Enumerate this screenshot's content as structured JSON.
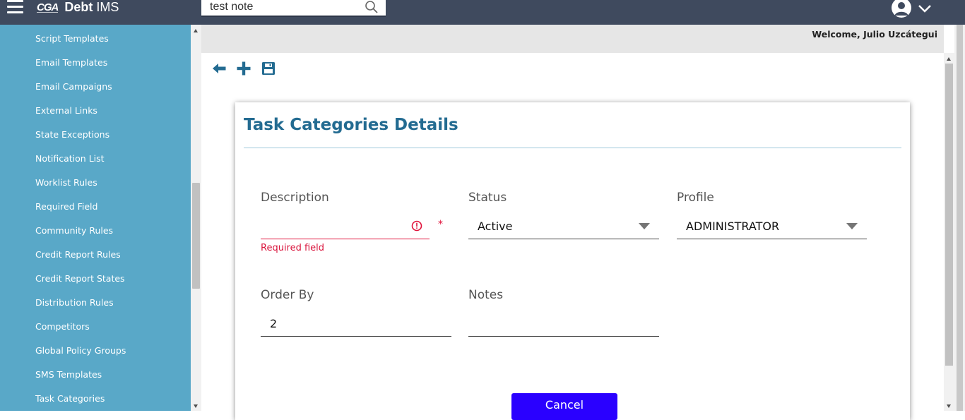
{
  "header": {
    "logo_mark": "CGA",
    "app_name_bold": "Debt",
    "app_name": "IMS",
    "search_value": "test note",
    "user_menu_icon": "chevron-down-icon"
  },
  "sidebar": {
    "items": [
      {
        "label": "Script Templates"
      },
      {
        "label": "Email Templates"
      },
      {
        "label": "Email Campaigns"
      },
      {
        "label": "External Links"
      },
      {
        "label": "State Exceptions"
      },
      {
        "label": "Notification List"
      },
      {
        "label": "Worklist Rules"
      },
      {
        "label": "Required Field"
      },
      {
        "label": "Community Rules"
      },
      {
        "label": "Credit Report Rules"
      },
      {
        "label": "Credit Report States"
      },
      {
        "label": "Distribution Rules"
      },
      {
        "label": "Competitors"
      },
      {
        "label": "Global Policy Groups"
      },
      {
        "label": "SMS Templates"
      },
      {
        "label": "Task Categories"
      }
    ]
  },
  "welcome_text": "Welcome, Julio Uzcátegui",
  "toolbar": {
    "icons": [
      "back-arrow-icon",
      "plus-icon",
      "save-icon"
    ]
  },
  "form": {
    "title": "Task Categories Details",
    "description": {
      "label": "Description",
      "value": "",
      "error": "Required field",
      "required_mark": "*"
    },
    "status": {
      "label": "Status",
      "value": "Active"
    },
    "profile": {
      "label": "Profile",
      "value": "ADMINISTRATOR"
    },
    "order_by": {
      "label": "Order By",
      "value": "2"
    },
    "notes": {
      "label": "Notes",
      "value": ""
    },
    "cancel_label": "Cancel"
  },
  "colors": {
    "topbar": "#3f4a5e",
    "sidebar": "#59a8c8",
    "title": "#236b91",
    "error": "#e0143c",
    "cancel_button": "#2a00ff"
  }
}
